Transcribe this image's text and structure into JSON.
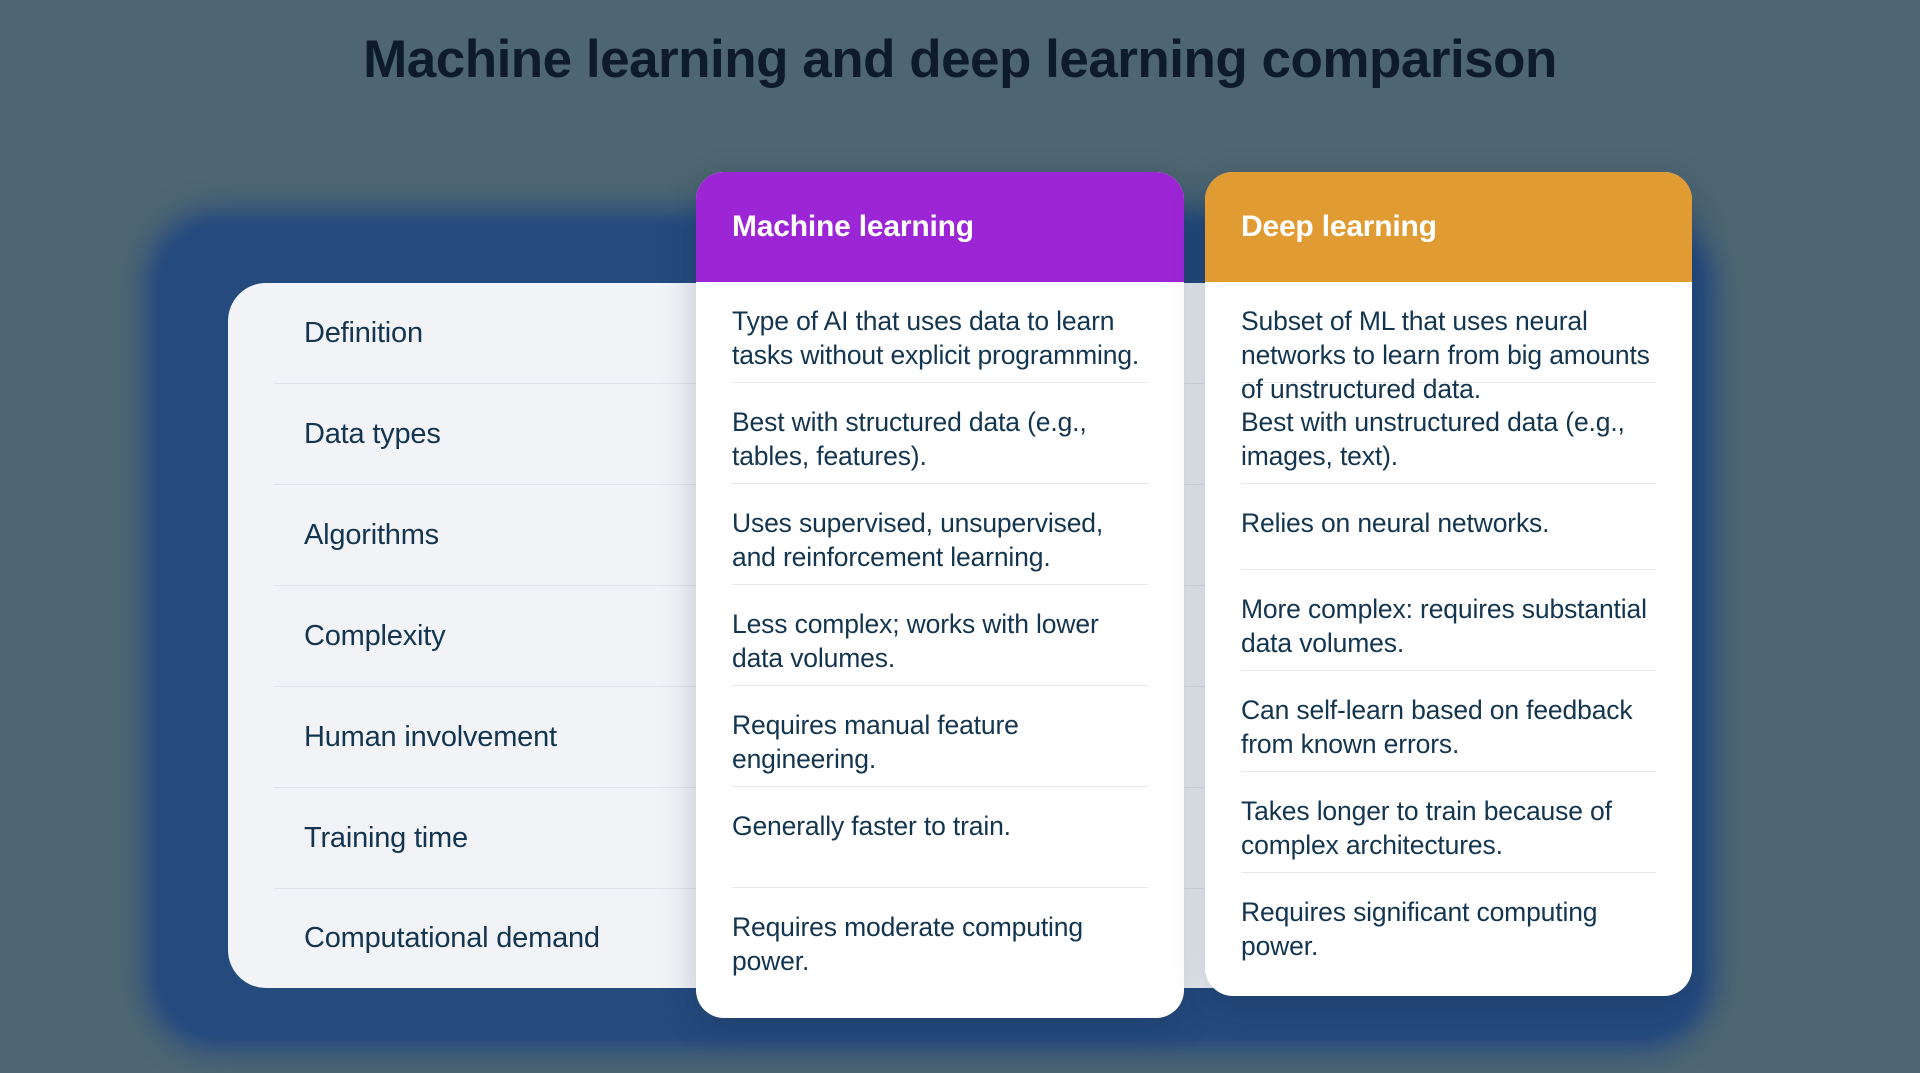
{
  "page": {
    "title": "Machine learning and deep learning comparison",
    "background_color": "#4d6671",
    "frame_color": "#254a7d",
    "label_panel_color": "#f1f3f7",
    "text_color": "#13354f"
  },
  "columns": {
    "ml": {
      "header": "Machine learning",
      "accent_color": "#9c26d6"
    },
    "dl": {
      "header": "Deep learning",
      "accent_color": "#e09b33"
    }
  },
  "rows": [
    {
      "label": "Definition",
      "ml": "Type of AI that uses data to learn tasks without explicit programming.",
      "dl": "Subset of ML that uses neural networks to learn from big amounts of unstructured data."
    },
    {
      "label": "Data types",
      "ml": "Best with structured data (e.g., tables, features).",
      "dl": "Best with unstructured data (e.g., images, text)."
    },
    {
      "label": "Algorithms",
      "ml": "Uses supervised, unsupervised, and reinforcement learning.",
      "dl": "Relies on neural networks."
    },
    {
      "label": "Complexity",
      "ml": "Less complex; works with lower data volumes.",
      "dl": "More complex: requires substantial data volumes."
    },
    {
      "label": "Human involvement",
      "ml": "Requires manual feature engineering.",
      "dl": "Can self-learn based on feedback from known errors."
    },
    {
      "label": "Training time",
      "ml": "Generally faster to train.",
      "dl": "Takes longer to train because of complex architectures."
    },
    {
      "label": "Computational demand",
      "ml": "Requires moderate computing power.",
      "dl": "Requires significant computing power."
    }
  ],
  "layout": {
    "label_row_heights": [
      101,
      101,
      101,
      101,
      101,
      101,
      99
    ],
    "ml_cell_heights": [
      101,
      101,
      101,
      101,
      101,
      101,
      101
    ],
    "dl_cell_heights": [
      101,
      101,
      86,
      101,
      101,
      101,
      101
    ]
  }
}
